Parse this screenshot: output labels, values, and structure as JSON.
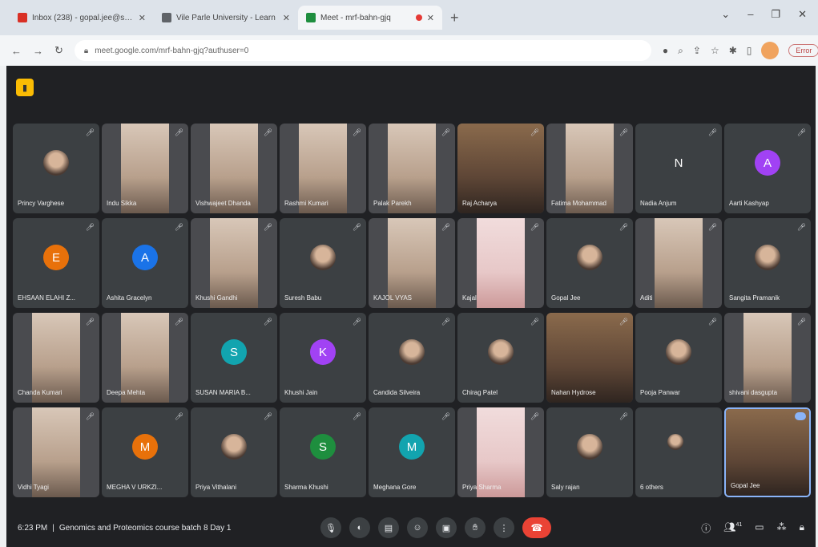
{
  "browser": {
    "tabs": [
      {
        "title": "Inbox (238) - gopal.jee@stu...",
        "icon": "gmail-icon",
        "color": "#d93025"
      },
      {
        "title": "Vile Parle University - Learn",
        "icon": "doc-icon",
        "color": "#5f6368"
      },
      {
        "title": "Meet - mrf-bahn-gjq",
        "icon": "meet-icon",
        "color": "#1e8e3e"
      }
    ],
    "url": "meet.google.com/mrf-bahn-gjq?authuser=0",
    "error_label": "Error"
  },
  "participants": [
    {
      "name": "Princy Varghese",
      "kind": "photo"
    },
    {
      "name": "Indu Sikka",
      "kind": "video"
    },
    {
      "name": "Vishwajeet Dhanda",
      "kind": "video"
    },
    {
      "name": "Rashmi Kumari",
      "kind": "video"
    },
    {
      "name": "Palak Parekh",
      "kind": "video"
    },
    {
      "name": "Raj Acharya",
      "kind": "wide"
    },
    {
      "name": "Fatima Mohammad",
      "kind": "video"
    },
    {
      "name": "Nadia Anjum",
      "kind": "letter",
      "letter": "N",
      "color": "#3c4043"
    },
    {
      "name": "Aarti Kashyap",
      "kind": "letter",
      "letter": "A",
      "color": "#a142f4"
    },
    {
      "name": "EHSAAN ELAHI Z...",
      "kind": "letter",
      "letter": "E",
      "color": "#e8710a"
    },
    {
      "name": "Ashita Gracelyn",
      "kind": "letter",
      "letter": "A",
      "color": "#1a73e8"
    },
    {
      "name": "Khushi Gandhi",
      "kind": "video"
    },
    {
      "name": "Suresh Babu",
      "kind": "photo"
    },
    {
      "name": "KAJOL VYAS",
      "kind": "video"
    },
    {
      "name": "Kajal",
      "kind": "pink"
    },
    {
      "name": "Gopal Jee",
      "kind": "photo"
    },
    {
      "name": "Aditi",
      "kind": "video"
    },
    {
      "name": "Sangita Pramanik",
      "kind": "photo"
    },
    {
      "name": "Chanda Kumari",
      "kind": "video"
    },
    {
      "name": "Deepa Mehta",
      "kind": "video"
    },
    {
      "name": "SUSAN MARIA B...",
      "kind": "letter",
      "letter": "S",
      "color": "#12a4af"
    },
    {
      "name": "Khushi Jain",
      "kind": "letter",
      "letter": "K",
      "color": "#a142f4"
    },
    {
      "name": "Candida Silveira",
      "kind": "photo"
    },
    {
      "name": "Chirag Patel",
      "kind": "photo"
    },
    {
      "name": "Nahan Hydrose",
      "kind": "wide"
    },
    {
      "name": "Pooja Panwar",
      "kind": "photo"
    },
    {
      "name": "shivani dasgupta",
      "kind": "video"
    },
    {
      "name": "Vidhi Tyagi",
      "kind": "video"
    },
    {
      "name": "MEGHA V URKZI...",
      "kind": "letter",
      "letter": "M",
      "color": "#e8710a"
    },
    {
      "name": "Priya Vithalani",
      "kind": "photo"
    },
    {
      "name": "Sharma Khushi",
      "kind": "letter",
      "letter": "S",
      "color": "#1e8e3e"
    },
    {
      "name": "Meghana Gore",
      "kind": "letter",
      "letter": "M",
      "color": "#12a4af"
    },
    {
      "name": "Priya Sharma",
      "kind": "pink"
    },
    {
      "name": "Saly rajan",
      "kind": "photo"
    },
    {
      "name": "6 others",
      "kind": "others"
    },
    {
      "name": "Gopal Jee",
      "kind": "self"
    }
  ],
  "bottom": {
    "time": "6:23 PM",
    "separator": "|",
    "meeting_title": "Genomics and Proteomics course batch 8 Day 1",
    "participant_count": "41"
  }
}
